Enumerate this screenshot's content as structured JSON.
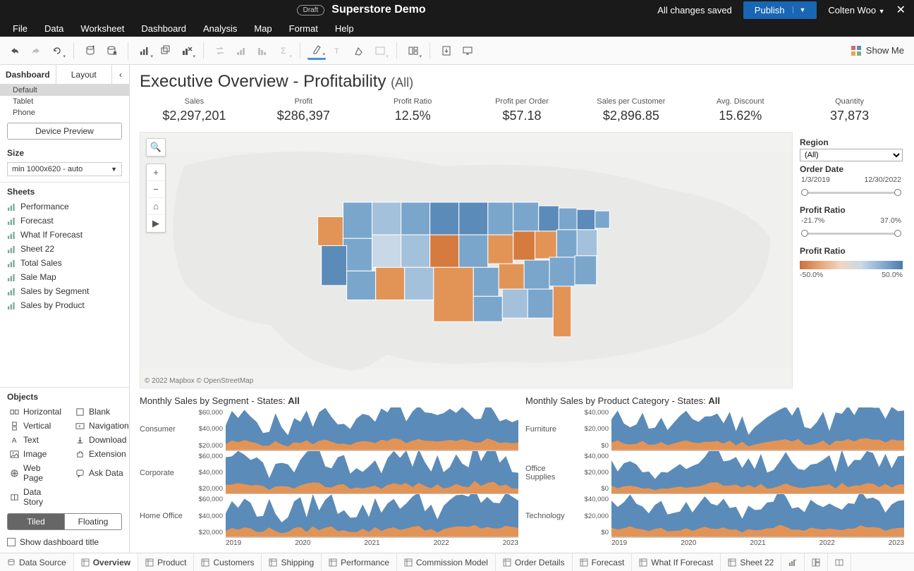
{
  "titlebar": {
    "draft": "Draft",
    "title": "Superstore Demo",
    "saved": "All changes saved",
    "publish": "Publish",
    "user": "Colten Woo"
  },
  "menu": [
    "File",
    "Data",
    "Worksheet",
    "Dashboard",
    "Analysis",
    "Map",
    "Format",
    "Help"
  ],
  "showme": "Show Me",
  "leftpane": {
    "tabs": [
      "Dashboard",
      "Layout"
    ],
    "devices": [
      "Default",
      "Tablet",
      "Phone"
    ],
    "device_preview": "Device Preview",
    "size_label": "Size",
    "size_value": "min 1000x620 - auto",
    "sheets_label": "Sheets",
    "sheets": [
      "Performance",
      "Forecast",
      "What If Forecast",
      "Sheet 22",
      "Total Sales",
      "Sale Map",
      "Sales by Segment",
      "Sales by Product"
    ],
    "objects_label": "Objects",
    "objects": [
      "Horizontal",
      "Blank",
      "Vertical",
      "Navigation",
      "Text",
      "Download",
      "Image",
      "Extension",
      "Web Page",
      "Ask Data",
      "Data Story"
    ],
    "toggle": [
      "Tiled",
      "Floating"
    ],
    "show_title": "Show dashboard title"
  },
  "dash": {
    "title": "Executive Overview - Profitability",
    "title_sub": "(All)",
    "kpis": [
      {
        "lbl": "Sales",
        "val": "$2,297,201"
      },
      {
        "lbl": "Profit",
        "val": "$286,397"
      },
      {
        "lbl": "Profit Ratio",
        "val": "12.5%"
      },
      {
        "lbl": "Profit per Order",
        "val": "$57.18"
      },
      {
        "lbl": "Sales per Customer",
        "val": "$2,896.85"
      },
      {
        "lbl": "Avg. Discount",
        "val": "15.62%"
      },
      {
        "lbl": "Quantity",
        "val": "37,873"
      }
    ],
    "map_attr": "© 2022 Mapbox   © OpenStreetMap",
    "legend": {
      "region": "Region",
      "region_val": "(All)",
      "orderdate": "Order Date",
      "date_from": "1/3/2019",
      "date_to": "12/30/2022",
      "pr": "Profit Ratio",
      "pr_min": "-21.7%",
      "pr_max": "37.0%",
      "grad_min": "-50.0%",
      "grad_max": "50.0%"
    },
    "seg_title_a": "Monthly Sales by Segment - States: ",
    "seg_title_b": "All",
    "prod_title_a": "Monthly Sales by Product Category - States: ",
    "prod_title_b": "All",
    "seg_rows": [
      "Consumer",
      "Corporate",
      "Home Office"
    ],
    "prod_rows": [
      "Furniture",
      "Office Supplies",
      "Technology"
    ],
    "seg_yticks": [
      "$60,000",
      "$40,000",
      "$20,000"
    ],
    "prod_yticks": [
      "$40,000",
      "$20,000",
      "$0"
    ],
    "xaxis": [
      "2019",
      "2020",
      "2021",
      "2022",
      "2023"
    ]
  },
  "bottomtabs": [
    "Data Source",
    "Overview",
    "Product",
    "Customers",
    "Shipping",
    "Performance",
    "Commission Model",
    "Order Details",
    "Forecast",
    "What If Forecast",
    "Sheet 22"
  ],
  "chart_data": {
    "kpis": {
      "Sales": 2297201,
      "Profit": 286397,
      "Profit Ratio": 0.125,
      "Profit per Order": 57.18,
      "Sales per Customer": 2896.85,
      "Avg. Discount": 0.1562,
      "Quantity": 37873
    },
    "profit_ratio_range": [
      -0.217,
      0.37
    ],
    "segment_sales": {
      "type": "area",
      "x_years": [
        2019,
        2020,
        2021,
        2022,
        2023
      ],
      "ylim": [
        0,
        75000
      ],
      "series_note": "stacked blue+orange per segment, 48 monthly points"
    },
    "product_sales": {
      "type": "area",
      "x_years": [
        2019,
        2020,
        2021,
        2022,
        2023
      ],
      "ylim": [
        0,
        50000
      ],
      "series_note": "stacked blue+orange per category, 48 monthly points"
    }
  }
}
